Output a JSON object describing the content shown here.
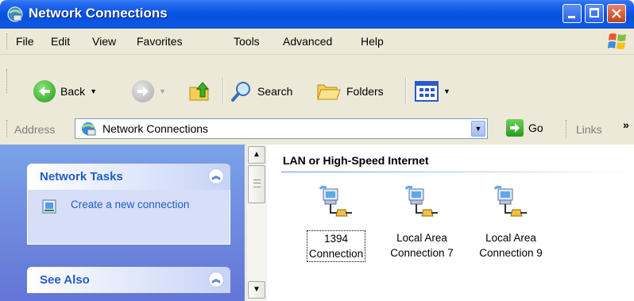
{
  "window": {
    "title": "Network Connections"
  },
  "menu": [
    "File",
    "Edit",
    "View",
    "Favorites",
    "Tools",
    "Advanced",
    "Help"
  ],
  "toolbar": {
    "back_label": "Back",
    "search_label": "Search",
    "folders_label": "Folders"
  },
  "address": {
    "label": "Address",
    "value": "Network Connections",
    "go_label": "Go",
    "links_label": "Links",
    "links_more": "»"
  },
  "task_pane": {
    "network_tasks": {
      "title": "Network Tasks",
      "items": [
        {
          "label": "Create a new connection"
        }
      ]
    },
    "see_also": {
      "title": "See Also"
    }
  },
  "content": {
    "group_header": "LAN or High-Speed Internet",
    "connections": [
      {
        "line1": "1394",
        "line2": "Connection",
        "selected": true
      },
      {
        "line1": "Local Area",
        "line2": "Connection 7",
        "selected": false
      },
      {
        "line1": "Local Area",
        "line2": "Connection 9",
        "selected": false
      }
    ]
  },
  "colors": {
    "titlebar": "#0b55e3",
    "task_pane": "#6f8ce0",
    "task_link": "#215dc6"
  }
}
